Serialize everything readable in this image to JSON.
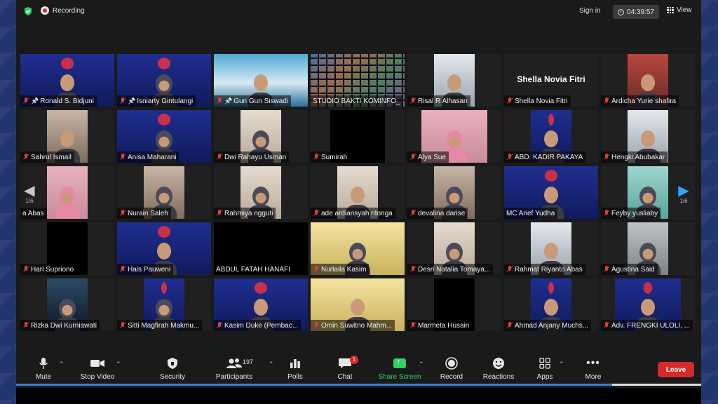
{
  "topbar": {
    "recording_label": "Recording",
    "signin_label": "Sign in",
    "timer": "04:39:57",
    "view_label": "View"
  },
  "pager": {
    "left": "1/6",
    "right": "1/6"
  },
  "tiles": [
    {
      "name": "Ronald S. Bidjuni",
      "pinned": true,
      "bg": "webinar",
      "video": "full"
    },
    {
      "name": "Isniarty Gintulangi",
      "pinned": true,
      "bg": "webinar",
      "video": "full"
    },
    {
      "name": "Gun Gun Siswadi",
      "pinned": true,
      "bg": "sea",
      "video": "full"
    },
    {
      "name": "STUDIO BAKTI KOMINFO_",
      "pinned": false,
      "bg": "mosaic",
      "video": "full",
      "no_mute": true
    },
    {
      "name": "Risal R Alhasan",
      "pinned": false,
      "bg": "office",
      "video": "center"
    },
    {
      "name": "Shella Novia Fitri",
      "pinned": false,
      "bg": "none",
      "video": "none",
      "big_name": "Shella Novia Fitri"
    },
    {
      "name": "Ardicha Yurie shafira",
      "pinned": false,
      "bg": "temple",
      "video": "center"
    },
    {
      "name": "Sahrul Ismail",
      "pinned": false,
      "bg": "room",
      "video": "center"
    },
    {
      "name": "Anisa Maharani",
      "pinned": false,
      "bg": "webinar",
      "video": "full"
    },
    {
      "name": "Dwi Rahayu Usman",
      "pinned": false,
      "bg": "wall",
      "video": "center"
    },
    {
      "name": "Sumirah",
      "pinned": false,
      "bg": "dark",
      "video": "wide"
    },
    {
      "name": "Alya Sue",
      "pinned": false,
      "bg": "pink",
      "video": "mid"
    },
    {
      "name": "ABD. KADIR PAKAYA",
      "pinned": false,
      "bg": "webinar",
      "video": "center"
    },
    {
      "name": "Hengki Abubakar",
      "pinned": false,
      "bg": "office",
      "video": "center"
    },
    {
      "name": "a Abas",
      "pinned": false,
      "bg": "pink",
      "video": "center",
      "no_mute": true
    },
    {
      "name": "Nurain Saleh",
      "pinned": false,
      "bg": "room",
      "video": "center"
    },
    {
      "name": "Rahmiya ngguti",
      "pinned": false,
      "bg": "wall",
      "video": "center"
    },
    {
      "name": "ade ardiansyah ritonga",
      "pinned": false,
      "bg": "wall",
      "video": "center"
    },
    {
      "name": "devalina darise",
      "pinned": false,
      "bg": "room",
      "video": "center"
    },
    {
      "name": "MC Arief Yudha",
      "pinned": false,
      "bg": "webinar",
      "video": "full",
      "active": true,
      "no_mute": true
    },
    {
      "name": "Feyby yusliaby",
      "pinned": false,
      "bg": "green",
      "video": "center"
    },
    {
      "name": "Hari Supriono",
      "pinned": false,
      "bg": "dark",
      "video": "center"
    },
    {
      "name": "Hais Pauweni",
      "pinned": false,
      "bg": "webinar",
      "video": "full"
    },
    {
      "name": "ABDUL FATAH HANAFI",
      "pinned": false,
      "bg": "dark",
      "video": "full",
      "no_mute": true
    },
    {
      "name": "Nurlaila Kasim",
      "pinned": false,
      "bg": "yellow",
      "video": "full"
    },
    {
      "name": "Desri Natalia Tomaya...",
      "pinned": false,
      "bg": "wall",
      "video": "center"
    },
    {
      "name": "Rahmat Riyanto Abas",
      "pinned": false,
      "bg": "office",
      "video": "center"
    },
    {
      "name": "Agustina Said",
      "pinned": false,
      "bg": "gray",
      "video": "center"
    },
    {
      "name": "Rizka Dwi Kurniawati",
      "pinned": false,
      "bg": "night",
      "video": "center"
    },
    {
      "name": "Sitti Magfirah Makmu...",
      "pinned": false,
      "bg": "webinar",
      "video": "center"
    },
    {
      "name": "Kasim Duke (Pembac...",
      "pinned": false,
      "bg": "webinar",
      "video": "full"
    },
    {
      "name": "Omin Suwitno Mahm...",
      "pinned": false,
      "bg": "yellow",
      "video": "full"
    },
    {
      "name": "Marmeta Husain",
      "pinned": false,
      "bg": "dark",
      "video": "center"
    },
    {
      "name": "Ahmad Anjany Muchs...",
      "pinned": false,
      "bg": "webinar",
      "video": "center"
    },
    {
      "name": "Adv. FRENGKI ULOLI, ...",
      "pinned": false,
      "bg": "webinar",
      "video": "mid"
    }
  ],
  "toolbar": {
    "mute": "Mute",
    "stop_video": "Stop Video",
    "security": "Security",
    "participants": "Participants",
    "participants_count": "197",
    "polls": "Polls",
    "chat": "Chat",
    "chat_badge": "1",
    "share_screen": "Share Screen",
    "record": "Record",
    "reactions": "Reactions",
    "apps": "Apps",
    "more": "More",
    "leave": "Leave"
  },
  "colors": {
    "accent_green": "#2fd06a",
    "leave_red": "#d42a2a",
    "active_speaker": "#d6d33a",
    "pager_blue": "#2aa8ff"
  }
}
